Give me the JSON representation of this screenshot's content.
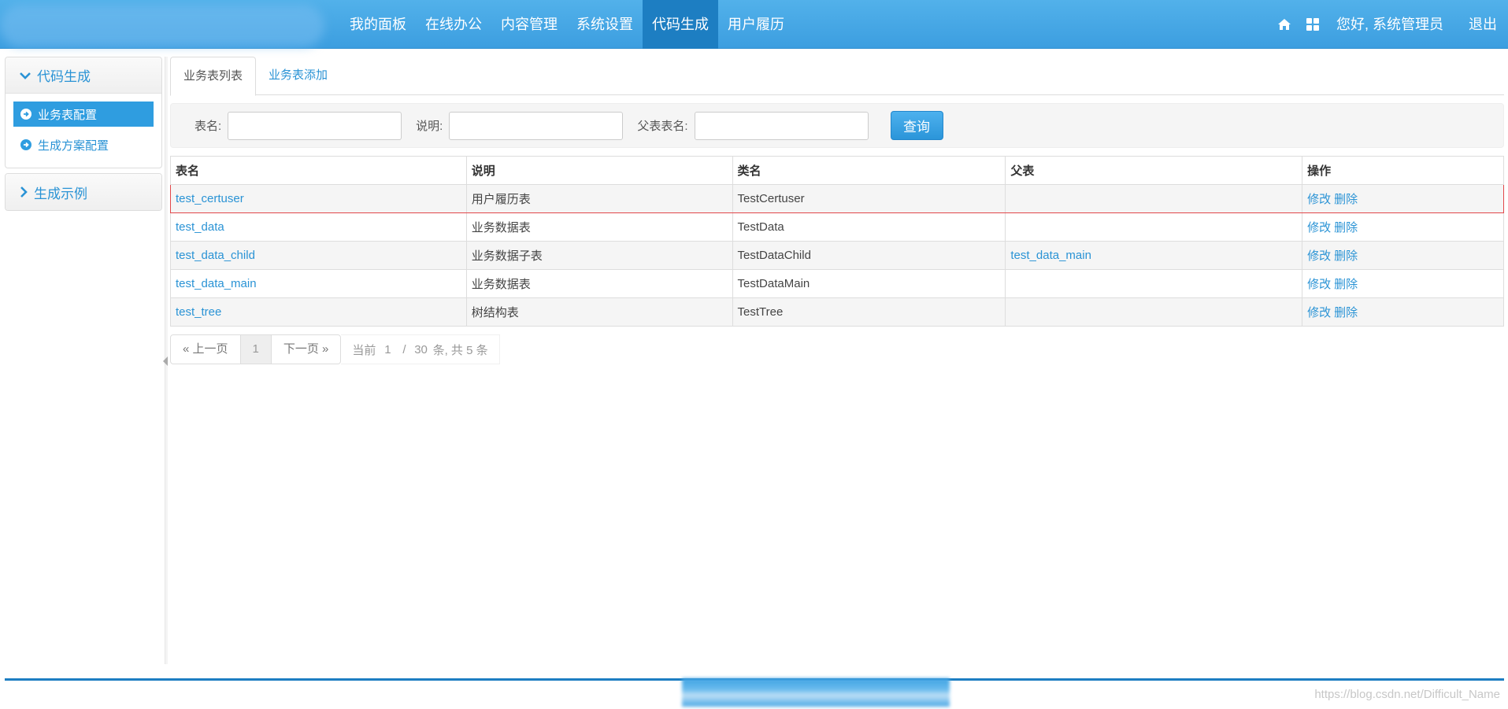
{
  "nav": {
    "menu": [
      "我的面板",
      "在线办公",
      "内容管理",
      "系统设置",
      "代码生成",
      "用户履历"
    ],
    "active_index": 4,
    "home_icon": "home-icon",
    "grid_icon": "grid-icon",
    "greeting": "您好, 系统管理员",
    "logout": "退出"
  },
  "sidebar": {
    "groups": [
      {
        "title": "代码生成",
        "icon": "chevron-down-icon",
        "items": [
          {
            "label": "业务表配置",
            "active": true
          },
          {
            "label": "生成方案配置",
            "active": false
          }
        ]
      },
      {
        "title": "生成示例",
        "icon": "chevron-right-icon",
        "items": []
      }
    ]
  },
  "tabs": [
    {
      "label": "业务表列表",
      "active": true
    },
    {
      "label": "业务表添加",
      "active": false
    }
  ],
  "search": {
    "table_name_label": "表名:",
    "table_name_value": "",
    "comment_label": "说明:",
    "comment_value": "",
    "parent_label": "父表表名:",
    "parent_value": "",
    "button": "查询"
  },
  "table": {
    "headers": [
      "表名",
      "说明",
      "类名",
      "父表",
      "操作"
    ],
    "rows": [
      {
        "name": "test_certuser",
        "comment": "用户履历表",
        "class": "TestCertuser",
        "parent": "",
        "highlight": true
      },
      {
        "name": "test_data",
        "comment": "业务数据表",
        "class": "TestData",
        "parent": "",
        "highlight": false
      },
      {
        "name": "test_data_child",
        "comment": "业务数据子表",
        "class": "TestDataChild",
        "parent": "test_data_main",
        "highlight": false
      },
      {
        "name": "test_data_main",
        "comment": "业务数据表",
        "class": "TestDataMain",
        "parent": "",
        "highlight": false
      },
      {
        "name": "test_tree",
        "comment": "树结构表",
        "class": "TestTree",
        "parent": "",
        "highlight": false
      }
    ],
    "ops": {
      "edit": "修改",
      "delete": "删除"
    }
  },
  "pager": {
    "prev": "« 上一页",
    "current_page": "1",
    "next": "下一页 »",
    "current_label": "当前",
    "page_input": "1",
    "slash": "/",
    "page_size": "30",
    "summary": "条, 共 5 条"
  },
  "footer": {
    "watermark": "https://blog.csdn.net/Difficult_Name"
  },
  "colors": {
    "nav_bg": "#3c9ee0",
    "nav_active": "#1d7ec2",
    "link": "#2a93d5",
    "highlight_border": "#e2474a"
  }
}
